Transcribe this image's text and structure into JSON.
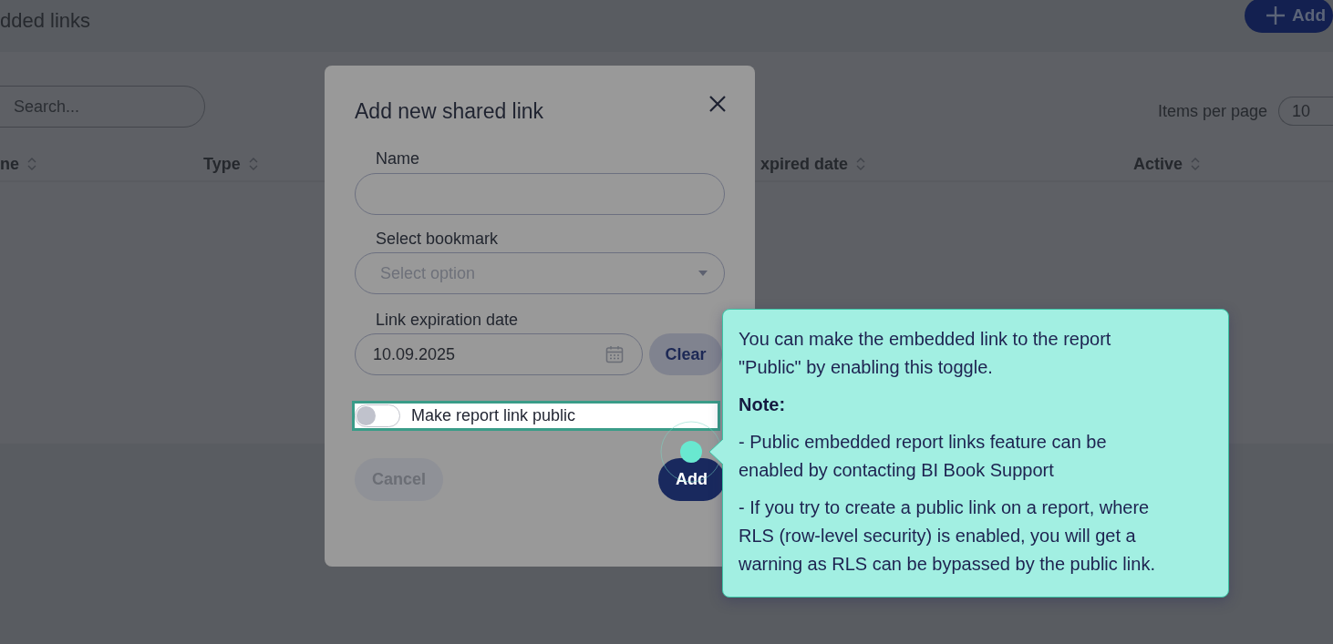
{
  "page": {
    "title": "dded links",
    "add_button": "Add",
    "search": {
      "placeholder": "Search..."
    },
    "items_per_page": {
      "label": "Items per page",
      "value": "10"
    },
    "columns": [
      "ne",
      "Type",
      "xpired date",
      "Active"
    ]
  },
  "modal": {
    "title": "Add new shared link",
    "fields": [
      {
        "kind": "text",
        "label": "Name"
      },
      {
        "kind": "select",
        "label": "Select bookmark",
        "placeholder": "Select option"
      },
      {
        "kind": "date",
        "label": "Link expiration date",
        "value": "10.09.2025",
        "action": "Clear"
      }
    ],
    "toggle": {
      "label": "Make report link public",
      "on": false,
      "highlighted": true
    },
    "buttons": [
      {
        "label": "Cancel",
        "kind": "secondary"
      },
      {
        "label": "Add",
        "kind": "primary"
      }
    ]
  },
  "tooltip": {
    "paragraphs": [
      {
        "kind": "text",
        "text": "You can make the embedded link to the report \"Public\" by enabling this toggle."
      },
      {
        "kind": "heading",
        "text": "Note:"
      },
      {
        "kind": "text",
        "text": "- Public embedded report links feature can be enabled by contacting BI Book Support"
      },
      {
        "kind": "text",
        "text": "- If you try to create a public link on a report, where RLS (row-level security) is enabled, you will get a warning as RLS can be bypassed by the public link."
      }
    ]
  }
}
